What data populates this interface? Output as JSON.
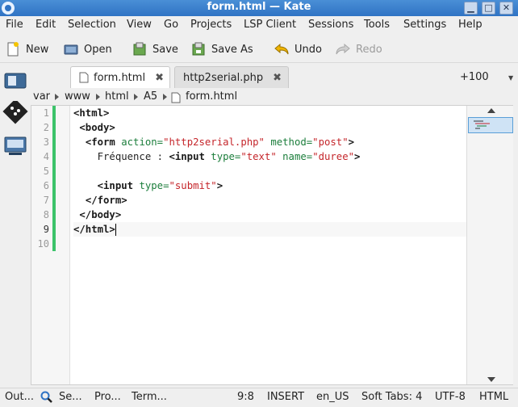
{
  "window": {
    "title": "form.html  — Kate"
  },
  "menu": [
    "File",
    "Edit",
    "Selection",
    "View",
    "Go",
    "Projects",
    "LSP Client",
    "Sessions",
    "Tools",
    "Settings",
    "Help"
  ],
  "toolbar": {
    "new_label": "New",
    "open_label": "Open",
    "save_label": "Save",
    "save_as_label": "Save As",
    "undo_label": "Undo",
    "redo_label": "Redo"
  },
  "tabs": [
    {
      "label": "form.html",
      "active": true
    },
    {
      "label": "http2serial.php",
      "active": false
    }
  ],
  "tab_overflow": "+100",
  "breadcrumb": [
    "var",
    "www",
    "html",
    "A5",
    "form.html"
  ],
  "editor": {
    "line_numbers": [
      "1",
      "2",
      "3",
      "4",
      "5",
      "6",
      "7",
      "8",
      "9",
      "10"
    ],
    "current_line": 9
  },
  "status": {
    "output": "Out...",
    "search": "Se...",
    "projects": "Pro...",
    "terminal": "Term...",
    "cursor_pos": "9:8",
    "mode": "INSERT",
    "language": "en_US",
    "indent": "Soft Tabs: 4",
    "encoding": "UTF-8",
    "syntax": "HTML"
  },
  "colors": {
    "title_bar": "#2f73c4",
    "modified_bar": "#3cc36a",
    "string": "#c5262b",
    "attribute": "#1c7e3c"
  }
}
